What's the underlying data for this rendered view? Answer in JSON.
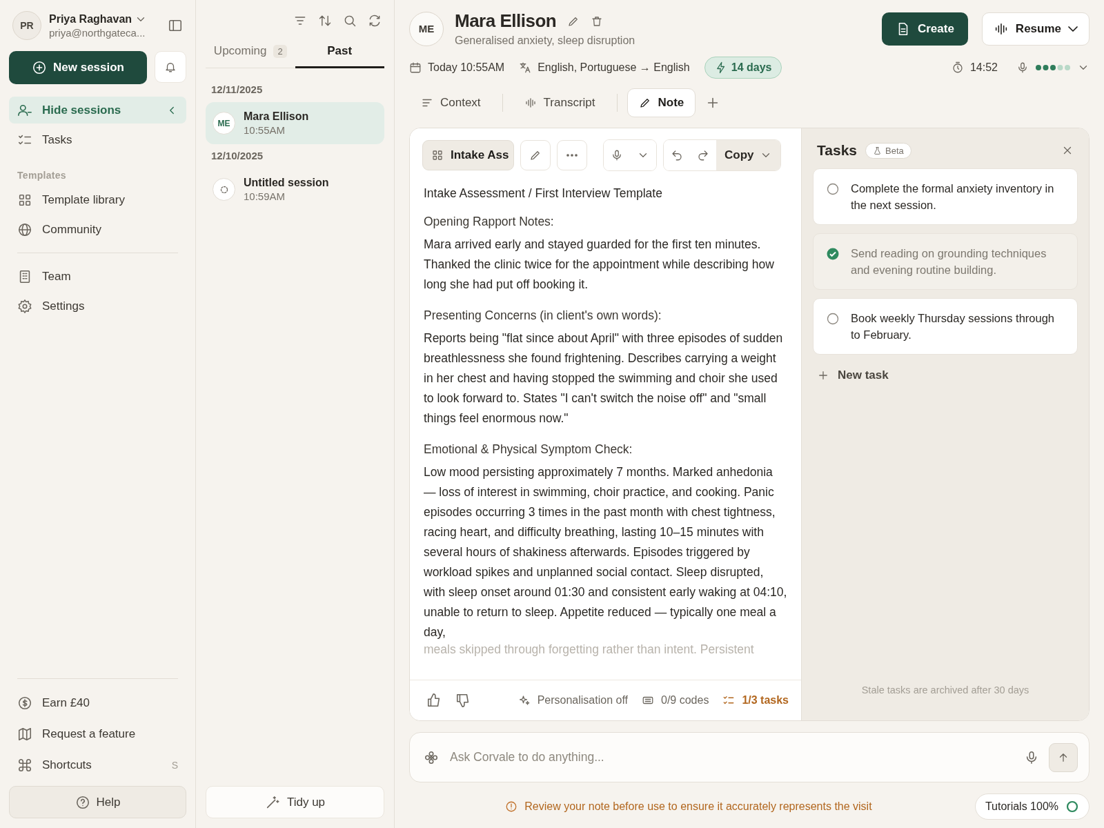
{
  "account": {
    "initials": "PR",
    "name": "Priya Raghavan",
    "email": "priya@northgateca..."
  },
  "new_session_button": "New session",
  "sidebar": {
    "nav": [
      {
        "label": "Hide sessions",
        "selected": true
      },
      {
        "label": "Tasks",
        "selected": false
      }
    ],
    "templates_heading": "Templates",
    "templates": [
      {
        "label": "Template library",
        "selected": false
      },
      {
        "label": "Community",
        "selected": false
      }
    ],
    "admin": [
      {
        "label": "Team",
        "selected": false
      },
      {
        "label": "Settings",
        "selected": false
      }
    ],
    "footer_links": [
      {
        "label": "Earn £40"
      },
      {
        "label": "Request a feature"
      },
      {
        "label": "Shortcuts",
        "shortcut": "S"
      }
    ],
    "help_button": "Help"
  },
  "session_list": {
    "tabs": [
      {
        "label": "Upcoming",
        "count": "2",
        "selected": false
      },
      {
        "label": "Past",
        "selected": true
      }
    ],
    "groups": [
      {
        "date": "12/11/2025",
        "sessions": [
          {
            "name": "Mara Ellison",
            "time": "10:55AM",
            "initials": "ME",
            "selected": true
          }
        ]
      },
      {
        "date": "12/10/2025",
        "sessions": [
          {
            "name": "Untitled session",
            "time": "10:59AM",
            "selected": false
          }
        ]
      }
    ],
    "tidy_button": "Tidy up"
  },
  "session": {
    "initials": "ME",
    "name": "Mara Ellison",
    "summary": "Generalised anxiety, sleep disruption",
    "create_button": "Create",
    "resume_button": "Resume",
    "date": "Today 10:55AM",
    "languages": "English, Portuguese → English",
    "retention": "14 days",
    "timer": "14:52",
    "mic_meter": {
      "level": 0.6
    }
  },
  "note_tabs": [
    {
      "label": "Context",
      "selected": false
    },
    {
      "label": "Transcript",
      "selected": false
    },
    {
      "label": "Note",
      "selected": true
    }
  ],
  "editor": {
    "template": "Intake Ass",
    "copy_button": "Copy",
    "title": "Intake Assessment / First Interview Template",
    "sections": [
      {
        "heading": "Opening Rapport Notes:",
        "body": "Mara arrived early and stayed guarded for the first ten minutes. Thanked the clinic twice for the appointment while describing how long she had put off booking it."
      },
      {
        "heading": "Presenting Concerns (in client's own words):",
        "body": "Reports being \"flat since about April\" with three episodes of sudden breathlessness she found frightening. Describes carrying a weight in her chest and having stopped the swimming and choir she used to look forward to. States \"I can't switch the noise off\" and \"small things feel enormous now.\""
      },
      {
        "heading": "Emotional & Physical Symptom Check:",
        "body": "Low mood persisting approximately 7 months. Marked anhedonia — loss of interest in swimming, choir practice, and cooking. Panic episodes occurring 3 times in the past month with chest tightness, racing heart, and difficulty breathing, lasting 10–15 minutes with several hours of shakiness afterwards. Episodes triggered by workload spikes and unplanned social contact. Sleep disrupted, with sleep onset around 01:30 and consistent early waking at 04:10, unable to return to sleep. Appetite reduced — typically one meal a day,"
      }
    ],
    "cut_line": "meals skipped through forgetting rather than intent. Persistent",
    "personalisation": "Personalisation off",
    "codes": "0/9 codes",
    "tasks_count": "1/3 tasks"
  },
  "tasks_panel": {
    "title": "Tasks",
    "badge": "Beta",
    "tasks": [
      {
        "text": "Complete the formal anxiety inventory in the next session.",
        "done": false
      },
      {
        "text": "Send reading on grounding techniques and evening routine building.",
        "done": true
      },
      {
        "text": "Book weekly Thursday sessions through to February.",
        "done": false
      }
    ],
    "new_task": "New task",
    "footnote": "Stale tasks are archived after 30 days"
  },
  "assistant": {
    "placeholder": "Ask Corvale to do anything..."
  },
  "notice": "Review your note before use to ensure it accurately represents the visit",
  "tutorials": {
    "label": "Tutorials 100%",
    "level": 1
  }
}
